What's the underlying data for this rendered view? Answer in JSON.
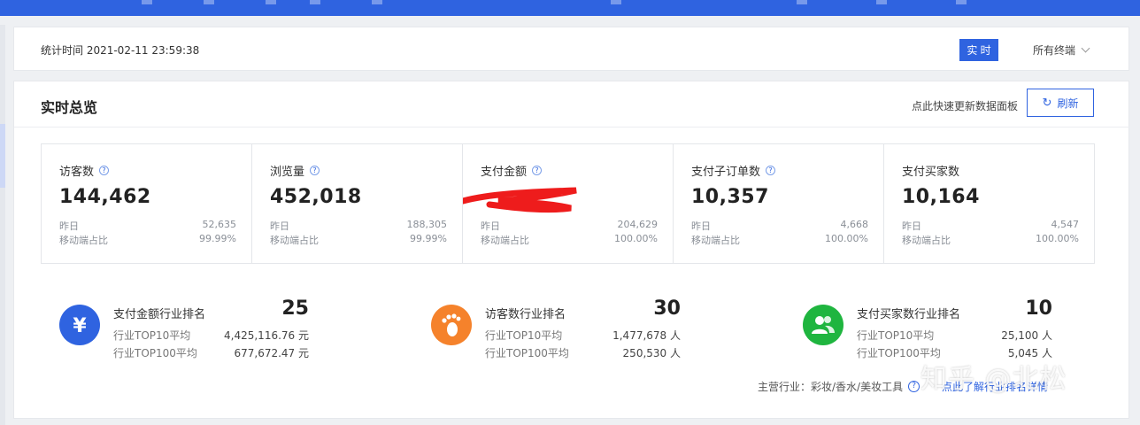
{
  "header": {
    "stat_time": "统计时间 2021-02-11 23:59:38",
    "realtime_button": "实 时",
    "terminal_select": "所有终端"
  },
  "overview": {
    "title": "实时总览",
    "refresh_hint": "点此快速更新数据面板",
    "refresh_button": "刷新",
    "refresh_icon": "refresh-icon"
  },
  "metrics": [
    {
      "label": "访客数",
      "value": "144,462",
      "yesterday_label": "昨日",
      "yesterday": "52,635",
      "mobile_label": "移动端占比",
      "mobile": "99.99%"
    },
    {
      "label": "浏览量",
      "value": "452,018",
      "yesterday_label": "昨日",
      "yesterday": "188,305",
      "mobile_label": "移动端占比",
      "mobile": "99.99%"
    },
    {
      "label": "支付金额",
      "value": "",
      "yesterday_label": "昨日",
      "yesterday": "204,629",
      "mobile_label": "移动端占比",
      "mobile": "100.00%"
    },
    {
      "label": "支付子订单数",
      "value": "10,357",
      "yesterday_label": "昨日",
      "yesterday": "4,668",
      "mobile_label": "移动端占比",
      "mobile": "100.00%"
    },
    {
      "label": "支付买家数",
      "value": "10,164",
      "yesterday_label": "昨日",
      "yesterday": "4,547",
      "mobile_label": "移动端占比",
      "mobile": "100.00%"
    }
  ],
  "rankings": [
    {
      "title": "支付金额行业排名",
      "rank": "25",
      "top10_label": "行业TOP10平均",
      "top10": "4,425,116.76 元",
      "top100_label": "行业TOP100平均",
      "top100": "677,672.47 元",
      "icon": "yen-icon",
      "color": "#2f63e0",
      "glyph": "¥"
    },
    {
      "title": "访客数行业排名",
      "rank": "30",
      "top10_label": "行业TOP10平均",
      "top10": "1,477,678 人",
      "top100_label": "行业TOP100平均",
      "top100": "250,530 人",
      "icon": "footprint-icon",
      "color": "#f5822b",
      "glyph": ""
    },
    {
      "title": "支付买家数行业排名",
      "rank": "10",
      "top10_label": "行业TOP10平均",
      "top10": "25,100 人",
      "top100_label": "行业TOP100平均",
      "top100": "5,045 人",
      "icon": "users-icon",
      "color": "#1fb53f",
      "glyph": ""
    }
  ],
  "footer": {
    "industry": "主营行业：彩妆/香水/美妆工具",
    "link": "点此了解行业排名详情"
  },
  "watermark": "知乎 @北松"
}
